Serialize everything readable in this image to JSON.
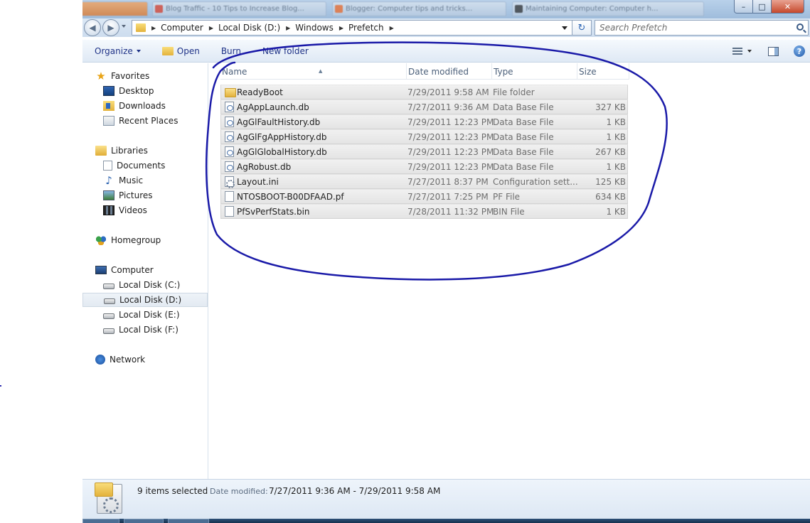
{
  "window": {
    "blurred_tabs": [
      "Blog Traffic - 10 Tips to Increase Blog...",
      "Blogger: Computer tips and tricks...",
      "Maintaining Computer: Computer h..."
    ],
    "blurred_tab_colors": [
      "#d8422f",
      "#ec6b2b",
      "#333333"
    ],
    "caption": {
      "minimize": "–",
      "maximize": "□",
      "close": "✕"
    }
  },
  "address": {
    "back_icon": "back-arrow-icon",
    "forward_icon": "forward-arrow-icon",
    "breadcrumbs": [
      "Computer",
      "Local Disk (D:)",
      "Windows",
      "Prefetch"
    ],
    "search_placeholder": "Search Prefetch"
  },
  "toolbar": {
    "organize": "Organize",
    "open": "Open",
    "burn": "Burn",
    "new_folder": "New folder",
    "help": "?"
  },
  "nav": {
    "favorites": {
      "label": "Favorites",
      "items": [
        "Desktop",
        "Downloads",
        "Recent Places"
      ]
    },
    "libraries": {
      "label": "Libraries",
      "items": [
        "Documents",
        "Music",
        "Pictures",
        "Videos"
      ]
    },
    "homegroup": "Homegroup",
    "computer": {
      "label": "Computer",
      "drives": [
        "Local Disk (C:)",
        "Local Disk (D:)",
        "Local Disk (E:)",
        "Local Disk (F:)"
      ],
      "selected": "Local Disk (D:)"
    },
    "network": "Network"
  },
  "file_list": {
    "columns": [
      "Name",
      "Date modified",
      "Type",
      "Size"
    ],
    "rows": [
      {
        "name": "ReadyBoot",
        "date": "7/29/2011 9:58 AM",
        "type": "File folder",
        "size": "",
        "icon": "folder"
      },
      {
        "name": "AgAppLaunch.db",
        "date": "7/27/2011 9:36 AM",
        "type": "Data Base File",
        "size": "327 KB",
        "icon": "db"
      },
      {
        "name": "AgGlFaultHistory.db",
        "date": "7/29/2011 12:23 PM",
        "type": "Data Base File",
        "size": "1 KB",
        "icon": "db"
      },
      {
        "name": "AgGlFgAppHistory.db",
        "date": "7/29/2011 12:23 PM",
        "type": "Data Base File",
        "size": "1 KB",
        "icon": "db"
      },
      {
        "name": "AgGlGlobalHistory.db",
        "date": "7/29/2011 12:23 PM",
        "type": "Data Base File",
        "size": "267 KB",
        "icon": "db"
      },
      {
        "name": "AgRobust.db",
        "date": "7/29/2011 12:23 PM",
        "type": "Data Base File",
        "size": "1 KB",
        "icon": "db"
      },
      {
        "name": "Layout.ini",
        "date": "7/27/2011 8:37 PM",
        "type": "Configuration sett...",
        "size": "125 KB",
        "icon": "ini"
      },
      {
        "name": "NTOSBOOT-B00DFAAD.pf",
        "date": "7/27/2011 7:25 PM",
        "type": "PF File",
        "size": "634 KB",
        "icon": "blank"
      },
      {
        "name": "PfSvPerfStats.bin",
        "date": "7/28/2011 11:32 PM",
        "type": "BIN File",
        "size": "1 KB",
        "icon": "blank"
      }
    ]
  },
  "annotation": {
    "color": "#1a1aa8"
  },
  "details": {
    "selection": "9 items selected",
    "date_label": "Date modified:",
    "date_value": "7/27/2011 9:36 AM - 7/29/2011 9:58 AM"
  }
}
